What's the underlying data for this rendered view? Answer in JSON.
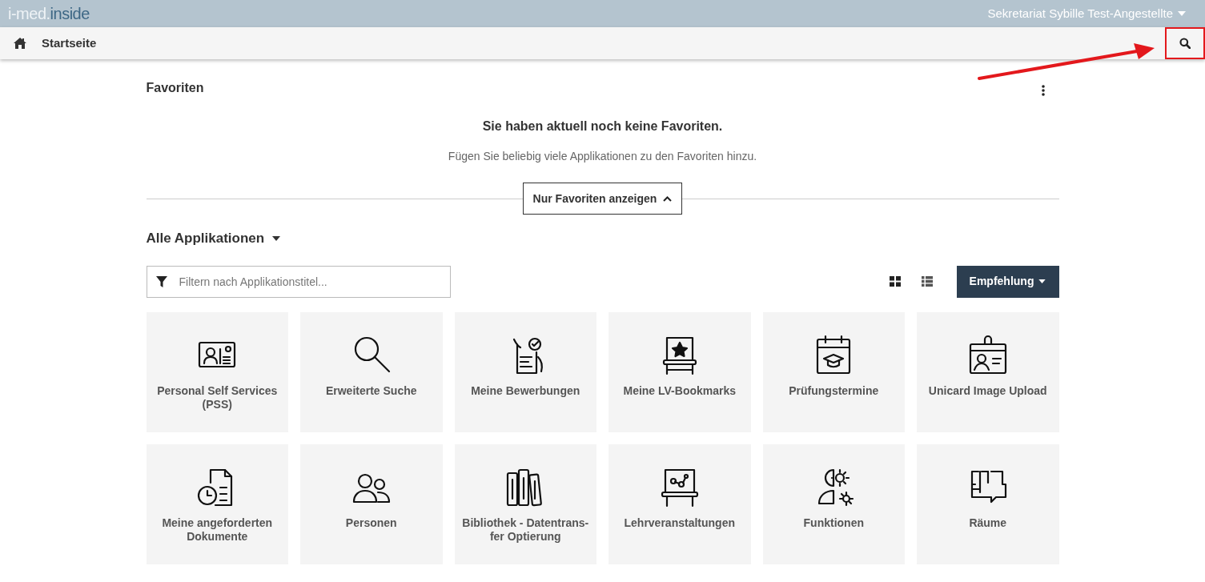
{
  "header": {
    "logo": [
      "i-med.",
      "inside"
    ],
    "user": "Sekretariat Sybille Test-Angestellte"
  },
  "nav": {
    "breadcrumb": "Startseite"
  },
  "favorites": {
    "title": "Favoriten",
    "empty_title": "Sie haben aktuell noch keine Favoriten.",
    "empty_text": "Fügen Sie beliebig viele Applikationen zu den Favoriten hinzu.",
    "toggle": "Nur Favoriten anzeigen"
  },
  "applications": {
    "title": "Alle Applikationen",
    "filter_placeholder": "Filtern nach Applikationstitel...",
    "sort": "Empfehlung",
    "views": [
      {
        "kind": "grid",
        "selected": true
      },
      {
        "kind": "list",
        "selected": false
      }
    ],
    "tiles": [
      {
        "label": "Personal Self Services (PSS)"
      },
      {
        "label": "Erweiterte Suche"
      },
      {
        "label": "Meine Bewerbungen"
      },
      {
        "label": "Meine LV-Bookmarks"
      },
      {
        "label": "Prüfungstermine"
      },
      {
        "label": "Unicard Image Upload"
      },
      {
        "label": "Meine angeforderten Dokumente"
      },
      {
        "label": "Personen"
      },
      {
        "label": "Bibliothek - Datentrans-\nfer Optierung"
      },
      {
        "label": "Lehrveranstaltungen"
      },
      {
        "label": "Funktionen"
      },
      {
        "label": "Räume"
      }
    ]
  }
}
